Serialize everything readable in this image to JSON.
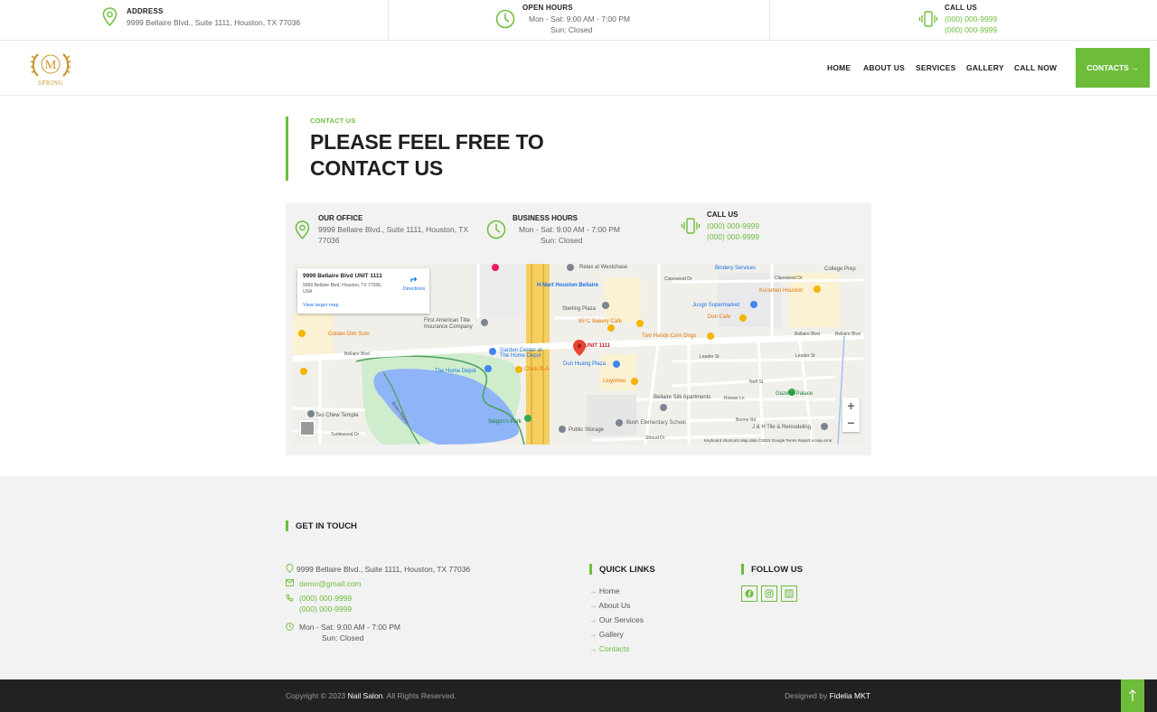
{
  "topbar": {
    "address": {
      "title": "ADDRESS",
      "text": "9999 Bellaire Blvd., Suite 1111, Houston, TX 77036",
      "icon": "location-pin-icon"
    },
    "hours": {
      "title": "OPEN HOURS",
      "line1": "Mon - Sat:  9:00 AM - 7:00 PM",
      "line2": "Sun:  Closed",
      "icon": "clock-icon"
    },
    "call": {
      "title": "CALL US",
      "phone1": "(000) 000-9999",
      "phone2": "(000) 000-9999",
      "icon": "phone-vibrate-icon"
    }
  },
  "logo": {
    "letter": "M",
    "wordmark": "SPRING"
  },
  "nav": {
    "items": [
      "HOME",
      "ABOUT US",
      "SERVICES",
      "GALLERY",
      "CALL NOW"
    ],
    "cta": "CONTACTS →"
  },
  "section": {
    "kicker": "CONTACT US",
    "title_line1": "PLEASE FEEL FREE TO",
    "title_line2": "CONTACT US"
  },
  "panel": {
    "office": {
      "title": "OUR OFFICE",
      "line1": "9999 Bellaire Blvd., Suite 1111, Houston, TX",
      "line2": "77036"
    },
    "hours": {
      "title": "BUSINESS HOURS",
      "line1": "Mon - Sat:  9:00 AM - 7:00 PM",
      "line2": "Sun:  Closed"
    },
    "call": {
      "title": "CALL US",
      "phone1": "(000) 000-9999",
      "phone2": "(000) 000-9999"
    }
  },
  "map": {
    "card_title": "9999 Bellaire Blvd UNIT 1111",
    "card_addr": "9999 Bellaire Blvd, Houston, TX 77036, USA",
    "card_link": "View larger map",
    "directions": "Directions",
    "pin_label": "UNIT 1111",
    "labels": [
      "Relax at Westchase",
      "Bindery Services",
      "College Prep",
      "Clarewood Dr",
      "Clarewood Dr",
      "Kuramen Houston",
      "H Mart Houston Bellaire",
      "Sterling Plaza",
      "Jusgo Supermarket",
      "85°C Bakery Cafe",
      "Don Cafe",
      "First American Title Insurance Company",
      "Golden Dim Sum",
      "Two Hands Corn Dogs",
      "Bellaire Blvd",
      "Bellaire Blvd",
      "Garden Center at The Home Depot",
      "Dun Huang Plaza",
      "The Home Depot",
      "Chick-fil-A",
      "Leader St",
      "Leader St",
      "Liuyishou",
      "Bellaire Silk Apartments",
      "Rowan Ln",
      "Gazebo Palace",
      "Teo Chew Temple",
      "Braes Bayou",
      "Saigon's Park",
      "Bush Elementary School",
      "Public Storage",
      "J & H Tile & Remodeling",
      "Turtlewood Dr",
      "Stroud Dr",
      "Boone Rd",
      "Neff St",
      "Bellaire Blvd"
    ],
    "footer": "Keyboard shortcuts    Map data ©2023 Google    Terms    Report a map error",
    "zoom_in": "+",
    "zoom_out": "−"
  },
  "footer": {
    "get_in_touch": "GET IN TOUCH",
    "address": "9999 Bellaire Blvd., Suite 1111, Houston, TX 77036",
    "email": "demo@gmail.com",
    "phone1": "(000) 000-9999",
    "phone2": "(000) 000-9999",
    "hours1": "Mon - Sat:  9:00 AM - 7:00 PM",
    "hours2": "Sun:  Closed",
    "quick_links_title": "QUICK LINKS",
    "quick_links": [
      "Home",
      "About Us",
      "Our Services",
      "Gallery",
      "Contacts"
    ],
    "follow_title": "FOLLOW US",
    "social_icons": [
      "facebook-icon",
      "instagram-icon",
      "grid-icon"
    ]
  },
  "bottom": {
    "copy_prefix": "Copyright © 2023",
    "brand": "Nail Salon",
    "copy_suffix": ". All Rights Reserved.",
    "designed_prefix": "Designed by",
    "designer": "Fidelia MKT"
  },
  "colors": {
    "accent": "#6dbd3b",
    "dark": "#222222",
    "footer_bg": "#f2f2f2",
    "gold": "#c8962e"
  }
}
